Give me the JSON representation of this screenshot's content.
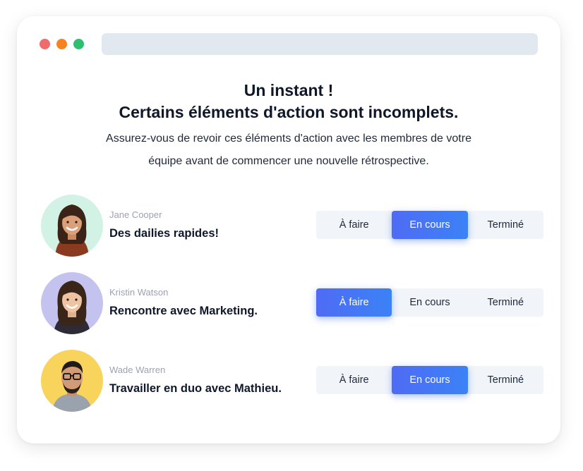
{
  "window": {
    "controls": [
      {
        "name": "close",
        "color": "#f26b6b"
      },
      {
        "name": "minimize",
        "color": "#f6831f"
      },
      {
        "name": "maximize",
        "color": "#2fbf71"
      }
    ]
  },
  "dialog": {
    "title_line1": "Un instant !",
    "title_line2": "Certains éléments d'action sont incomplets.",
    "description": "Assurez-vous de revoir ces éléments d'action avec les membres de votre équipe avant de commencer une nouvelle rétrospective."
  },
  "status_options": [
    "À faire",
    "En cours",
    "Terminé"
  ],
  "items": [
    {
      "person": "Jane Cooper",
      "task": "Des dailies rapides!",
      "status": "En cours",
      "avatar_bg": "#d1f2e4"
    },
    {
      "person": "Kristin Watson",
      "task": "Rencontre avec Marketing.",
      "status": "À faire",
      "avatar_bg": "#c4c2ef"
    },
    {
      "person": "Wade Warren",
      "task": "Travailler en duo avec Mathieu.",
      "status": "En cours",
      "avatar_bg": "#f9d45c"
    }
  ]
}
